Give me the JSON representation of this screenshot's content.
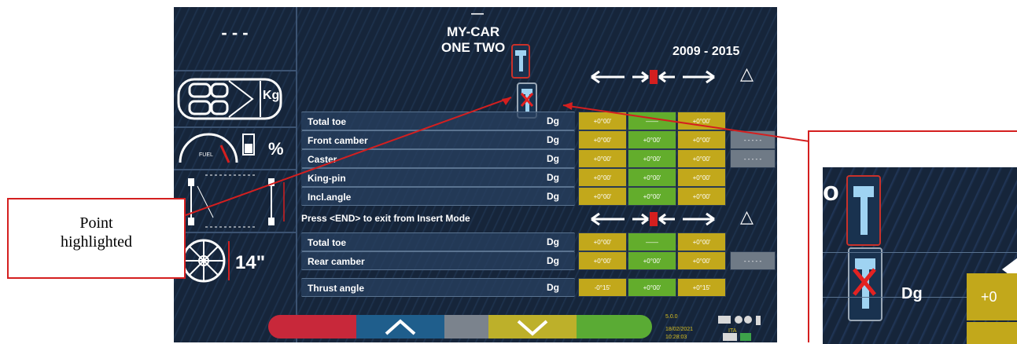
{
  "left_panel": {
    "dashes": "- - -",
    "kg_label": "Kg",
    "fuel_label": "FUEL",
    "percent_label": "%",
    "wheel_size": "14\""
  },
  "header": {
    "top_mark": "—",
    "make": "MY-CAR",
    "model": "ONE TWO",
    "years": "2009 - 2015",
    "triangle": "△"
  },
  "front_rows": [
    {
      "label": "Total toe",
      "unit": "Dg",
      "min": "+0°00'",
      "nominal": "——",
      "max": "+0°00'",
      "extra": ""
    },
    {
      "label": "Front camber",
      "unit": "Dg",
      "min": "+0°00'",
      "nominal": "+0°00'",
      "max": "+0°00'",
      "extra": "- - - - -"
    },
    {
      "label": "Caster",
      "unit": "Dg",
      "min": "+0°00'",
      "nominal": "+0°00'",
      "max": "+0°00'",
      "extra": "- - - - -"
    },
    {
      "label": "King-pin",
      "unit": "Dg",
      "min": "+0°00'",
      "nominal": "+0°00'",
      "max": "+0°00'",
      "extra": ""
    },
    {
      "label": "Incl.angle",
      "unit": "Dg",
      "min": "+0°00'",
      "nominal": "+0°00'",
      "max": "+0°00'",
      "extra": ""
    }
  ],
  "rear_section": {
    "heading": "Press <END> to exit from Insert Mode",
    "triangle": "△"
  },
  "rear_rows": [
    {
      "label": "Total toe",
      "unit": "Dg",
      "min": "+0°00'",
      "nominal": "——",
      "max": "+0°00'",
      "extra": ""
    },
    {
      "label": "Rear camber",
      "unit": "Dg",
      "min": "+0°00'",
      "nominal": "+0°00'",
      "max": "+0°00'",
      "extra": "- - - - -"
    },
    {
      "label": "Thrust angle",
      "unit": "Dg",
      "min": "-0°15'",
      "nominal": "+0°00'",
      "max": "+0°15'",
      "extra": ""
    }
  ],
  "status": {
    "version": "5.0.0",
    "date": "18/02/2021",
    "time": "10:28:03",
    "lang": "ITA"
  },
  "callout": {
    "line1": "Point",
    "line2": "highlighted"
  },
  "zoom": {
    "unit": "Dg",
    "value_fragment": "+0",
    "char_fragment": "o"
  },
  "colors": {
    "accent_red": "#d41f1f",
    "cell_yellow": "#c2a81b",
    "cell_green": "#63ad2c"
  }
}
